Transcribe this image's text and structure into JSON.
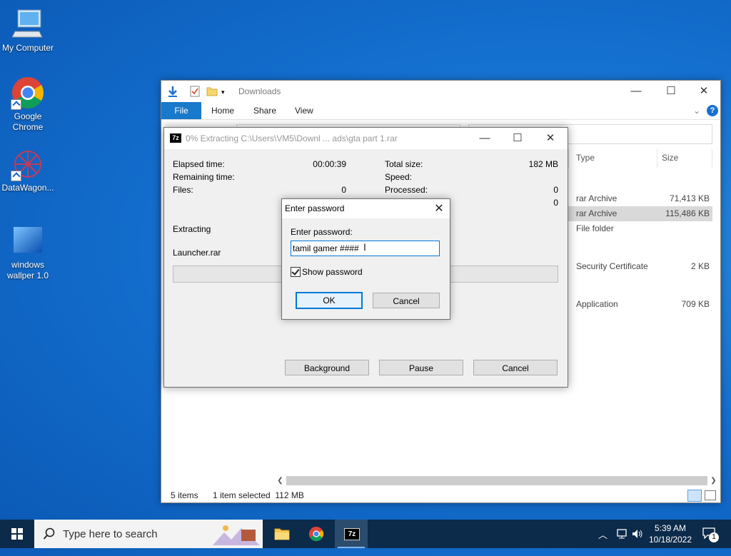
{
  "desktop": {
    "icons": [
      {
        "label": "My Computer"
      },
      {
        "label": "Google Chrome"
      },
      {
        "label": "DataWagon..."
      },
      {
        "label": "windows wallper 1.0"
      }
    ]
  },
  "explorer": {
    "title": "Downloads",
    "ribbon": {
      "file": "File",
      "home": "Home",
      "share": "Share",
      "view": "View"
    },
    "columns": {
      "type": "Type",
      "size": "Size"
    },
    "rows": [
      {
        "type": "rar Archive",
        "size": "71,413 KB",
        "selected": false
      },
      {
        "type": "rar Archive",
        "size": "115,486 KB",
        "selected": true
      },
      {
        "type": "File folder",
        "size": "",
        "selected": false
      },
      {
        "type": "Security Certificate",
        "size": "2 KB",
        "selected": false
      },
      {
        "type": "Application",
        "size": "709 KB",
        "selected": false
      }
    ],
    "status": {
      "items": "5 items",
      "selected": "1 item selected  112 MB"
    }
  },
  "zip": {
    "logo": "7z",
    "title": "0% Extracting C:\\Users\\VM5\\Downl ... ads\\gta part 1.rar",
    "labels": {
      "elapsed": "Elapsed time:",
      "remaining": "Remaining time:",
      "files": "Files:",
      "total": "Total size:",
      "speed": "Speed:",
      "processed": "Processed:"
    },
    "values": {
      "elapsed": "00:00:39",
      "files": "0",
      "total": "182 MB",
      "processed": "0",
      "extra": "0"
    },
    "extracting": "Extracting",
    "current_file": "Launcher.rar",
    "buttons": {
      "background": "Background",
      "pause": "Pause",
      "cancel": "Cancel"
    }
  },
  "password_dialog": {
    "title": "Enter password",
    "label": "Enter password:",
    "value": "tamil gamer ####",
    "show_password": "Show password",
    "ok": "OK",
    "cancel": "Cancel"
  },
  "taskbar": {
    "search_placeholder": "Type here to search",
    "time": "5:39 AM",
    "date": "10/18/2022",
    "notification_count": "1"
  }
}
